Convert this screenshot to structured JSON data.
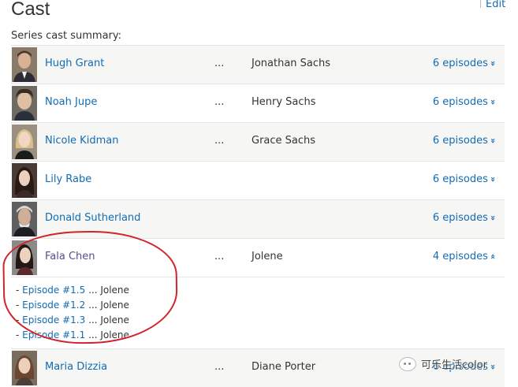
{
  "header": {
    "title": "Cast",
    "edit_label": "Edit",
    "summary_label": "Series cast summary:"
  },
  "cast": [
    {
      "actor": "Hugh Grant",
      "dots": "...",
      "character": "Jonathan Sachs",
      "episodes": "6 episodes",
      "expanded": false
    },
    {
      "actor": "Noah Jupe",
      "dots": "...",
      "character": "Henry Sachs",
      "episodes": "6 episodes",
      "expanded": false
    },
    {
      "actor": "Nicole Kidman",
      "dots": "...",
      "character": "Grace Sachs",
      "episodes": "6 episodes",
      "expanded": false
    },
    {
      "actor": "Lily Rabe",
      "dots": "",
      "character": "",
      "episodes": "6 episodes",
      "expanded": false
    },
    {
      "actor": "Donald Sutherland",
      "dots": "",
      "character": "",
      "episodes": "6 episodes",
      "expanded": false
    },
    {
      "actor": "Fala Chen",
      "dots": "...",
      "character": "Jolene",
      "episodes": "4 episodes",
      "expanded": true
    },
    {
      "actor": "Maria Dizzia",
      "dots": "...",
      "character": "Diane Porter",
      "episodes": "6 episodes",
      "expanded": false
    }
  ],
  "expanded_episodes": [
    {
      "prefix": "- ",
      "episode": "Episode #1.5",
      "sep": " ... ",
      "character": "Jolene"
    },
    {
      "prefix": "- ",
      "episode": "Episode #1.2",
      "sep": " ... ",
      "character": "Jolene"
    },
    {
      "prefix": "- ",
      "episode": "Episode #1.3",
      "sep": " ... ",
      "character": "Jolene"
    },
    {
      "prefix": "- ",
      "episode": "Episode #1.1",
      "sep": " ... ",
      "character": "Jolene"
    }
  ],
  "icons": {
    "collapsed": "chevron-double-down-icon",
    "expanded": "chevron-double-up-icon"
  },
  "colors": {
    "link": "#136cb2",
    "visited_link": "#5b4a8f",
    "row_alt": "#f6f6f5",
    "annotation": "#d2232a"
  },
  "watermark": {
    "text": "可乐生活color"
  }
}
